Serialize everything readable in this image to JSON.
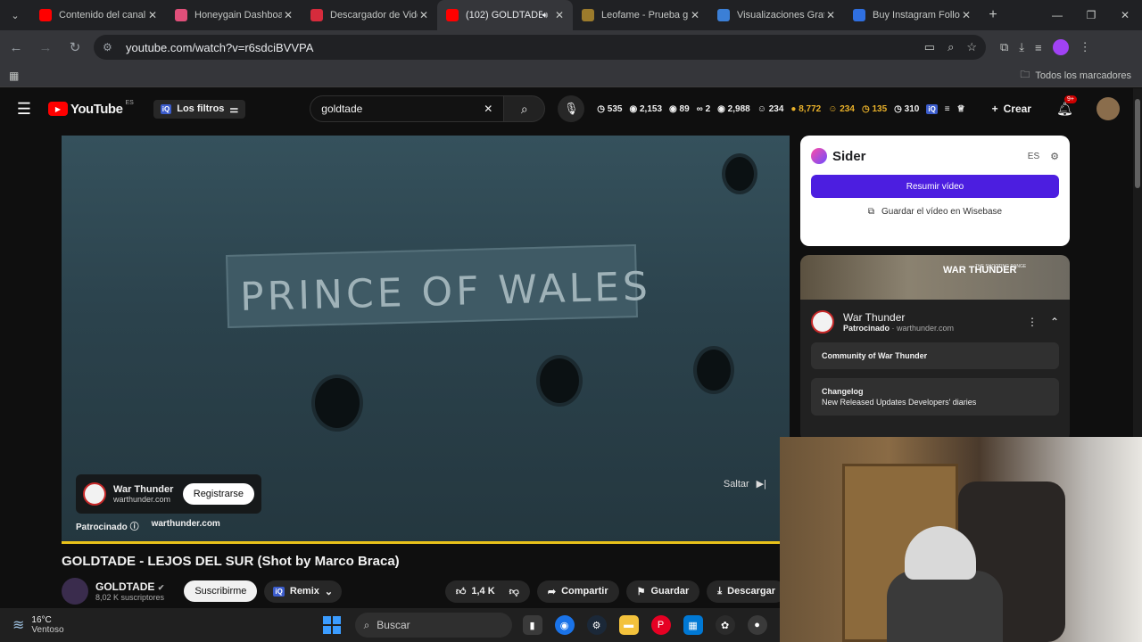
{
  "browser": {
    "tabs": [
      {
        "title": "Contenido del canal",
        "color": "#ff0000",
        "active": false
      },
      {
        "title": "Honeygain Dashboar",
        "color": "#e04f7a",
        "active": false
      },
      {
        "title": "Descargador de Vide",
        "color": "#d62b3c",
        "active": false
      },
      {
        "title": "(102) GOLDTADE",
        "color": "#ff0000",
        "active": true
      },
      {
        "title": "Leofame - Prueba gr",
        "color": "#9c7b2c",
        "active": false
      },
      {
        "title": "Visualizaciones Grat",
        "color": "#3b7fd6",
        "active": false
      },
      {
        "title": "Buy Instagram Follo",
        "color": "#2f6fe0",
        "active": false
      }
    ],
    "url": "youtube.com/watch?v=r6sdciBVVPA",
    "bookmarks_label": "Todos los marcadores"
  },
  "yt": {
    "logo": "YouTube",
    "logo_cc": "ES",
    "filters": "Los filtros",
    "iq": "iQ",
    "search_query": "goldtade",
    "stats": [
      "535",
      "2,153",
      "89",
      "2",
      "2,988",
      "234",
      "8,772",
      "234",
      "135",
      "310"
    ],
    "create": "Crear",
    "notif_badge": "9+"
  },
  "video": {
    "plate_text": "PRINCE OF WALES",
    "advertiser": "War Thunder",
    "ad_url": "warthunder.com",
    "register": "Registrarse",
    "sponsored": "Patrocinado",
    "sponsored_url": "warthunder.com",
    "skip": "Saltar",
    "title": "GOLDTADE - LEJOS DEL SUR (Shot by Marco Braca)"
  },
  "channel": {
    "name": "GOLDTADE",
    "subs": "8,02 K suscriptores",
    "subscribe": "Suscribirme",
    "remix": "Remix",
    "likes": "1,4 K",
    "share": "Compartir",
    "save": "Guardar",
    "download": "Descargar"
  },
  "sider": {
    "name": "Sider",
    "lang": "ES",
    "summarize": "Resumir vídeo",
    "save_wisebase": "Guardar el vídeo en Wisebase"
  },
  "adcard": {
    "banner_title": "WAR THUNDER",
    "banner_small": "THE SHOOTING RANGE",
    "name": "War Thunder",
    "sponsored": "Patrocinado",
    "url": "warthunder.com",
    "links": [
      {
        "title": "Community of War Thunder",
        "sub": ""
      },
      {
        "title": "Changelog",
        "sub": "New Released Updates Developers' diaries"
      }
    ]
  },
  "taskbar": {
    "temp": "16°C",
    "weather": "Ventoso",
    "search": "Buscar"
  }
}
